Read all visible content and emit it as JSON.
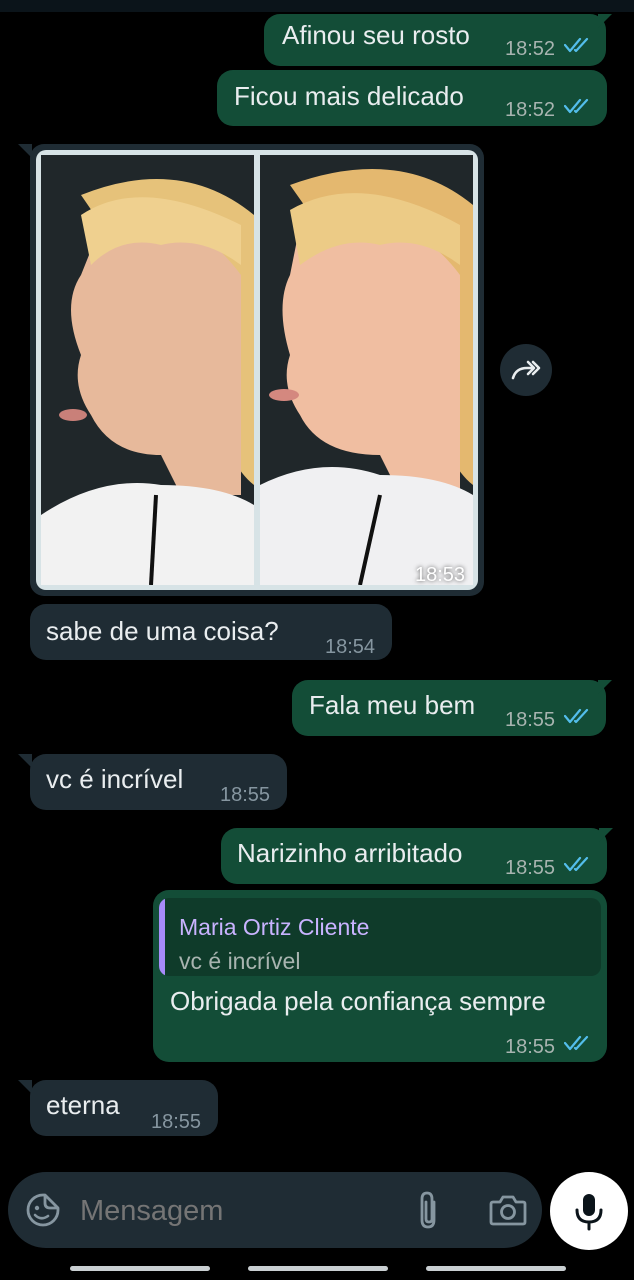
{
  "messages": [
    {
      "text": "Afinou seu rosto",
      "time": "18:52",
      "dir": "out",
      "status": "read"
    },
    {
      "text": "Ficou mais delicado",
      "time": "18:52",
      "dir": "out",
      "status": "read"
    },
    {
      "type": "image",
      "time": "18:53",
      "dir": "in"
    },
    {
      "text": "sabe de uma coisa?",
      "time": "18:54",
      "dir": "in"
    },
    {
      "text": "Fala meu bem",
      "time": "18:55",
      "dir": "out",
      "status": "read"
    },
    {
      "text": "vc é incrível",
      "time": "18:55",
      "dir": "in"
    },
    {
      "text": "Narizinho arribitado",
      "time": "18:55",
      "dir": "out",
      "status": "read"
    },
    {
      "text": "Obrigada pela confiança sempre",
      "time": "18:55",
      "dir": "out",
      "status": "read",
      "reply_to": {
        "author": "Maria Ortiz Cliente",
        "text": "vc é incrível"
      }
    },
    {
      "text": "eterna",
      "time": "18:55",
      "dir": "in"
    }
  ],
  "composer": {
    "placeholder": "Mensagem"
  },
  "icons": {
    "sticker": "sticker-icon",
    "attach": "paperclip-icon",
    "camera": "camera-icon",
    "mic": "microphone-icon",
    "forward": "forward-icon",
    "ticks": "double-check-icon"
  },
  "colors": {
    "outgoing_bubble": "#134d37",
    "incoming_bubble": "#1f2c34",
    "read_ticks": "#53bdeb",
    "reply_author": "#c9b3ff",
    "reply_bar": "#a78bfa"
  }
}
